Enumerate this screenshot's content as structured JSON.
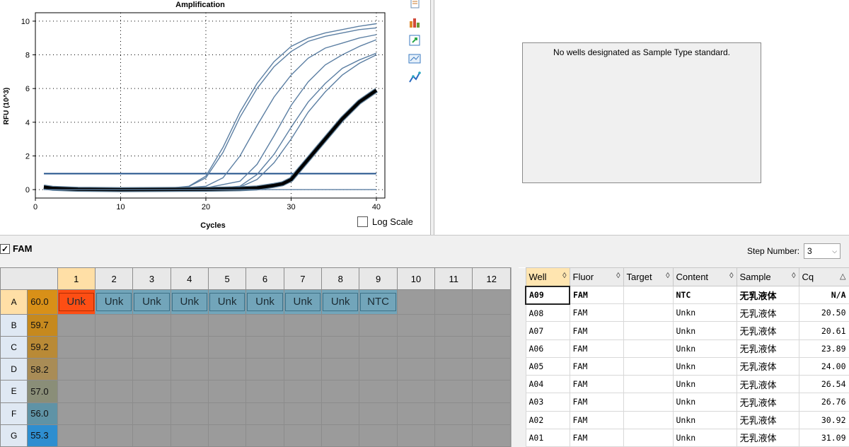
{
  "chart": {
    "title": "Amplification",
    "xlabel": "Cycles",
    "ylabel": "RFU (10^3)",
    "log_scale_label": "Log Scale"
  },
  "chart_data": {
    "type": "line",
    "title": "Amplification",
    "xlabel": "Cycles",
    "ylabel": "RFU (10^3)",
    "xlim": [
      0,
      41
    ],
    "ylim": [
      -0.5,
      10.5
    ],
    "xticks": [
      0,
      10,
      20,
      30,
      40
    ],
    "yticks": [
      0,
      2,
      4,
      6,
      8,
      10
    ],
    "grid": "dotted",
    "threshold": 0.95,
    "series": [
      {
        "x": [
          1,
          2,
          5,
          10,
          15,
          18,
          20,
          22,
          24,
          26,
          28,
          30,
          32,
          34,
          36,
          38,
          40
        ],
        "y": [
          0.1,
          0.05,
          0.02,
          0.0,
          0.05,
          0.2,
          0.8,
          2.5,
          4.6,
          6.3,
          7.6,
          8.5,
          9.0,
          9.3,
          9.5,
          9.7,
          9.85
        ]
      },
      {
        "x": [
          1,
          2,
          5,
          10,
          15,
          18,
          20,
          22,
          24,
          26,
          28,
          30,
          32,
          34,
          36,
          38,
          40
        ],
        "y": [
          0.15,
          0.08,
          0.02,
          0.0,
          0.04,
          0.18,
          0.7,
          2.2,
          4.3,
          6.0,
          7.3,
          8.2,
          8.8,
          9.1,
          9.3,
          9.5,
          9.6
        ]
      },
      {
        "x": [
          1,
          2,
          5,
          10,
          15,
          20,
          22,
          24,
          26,
          28,
          30,
          32,
          34,
          36,
          38,
          40
        ],
        "y": [
          0.1,
          0.05,
          0.02,
          0.0,
          0.02,
          0.2,
          0.7,
          2.0,
          3.8,
          5.5,
          6.8,
          7.8,
          8.4,
          8.7,
          9.0,
          9.2
        ]
      },
      {
        "x": [
          1,
          2,
          5,
          10,
          15,
          20,
          24,
          26,
          28,
          30,
          32,
          34,
          36,
          38,
          40
        ],
        "y": [
          0.1,
          0.05,
          0.02,
          0.0,
          0.02,
          0.1,
          0.5,
          1.5,
          3.2,
          5.0,
          6.4,
          7.4,
          8.0,
          8.5,
          8.9
        ]
      },
      {
        "x": [
          1,
          2,
          5,
          10,
          15,
          20,
          24,
          26,
          28,
          30,
          32,
          34,
          36,
          38,
          40
        ],
        "y": [
          0.25,
          0.1,
          0.02,
          0.0,
          0.02,
          0.05,
          0.2,
          0.9,
          2.1,
          3.7,
          5.2,
          6.3,
          7.2,
          7.7,
          8.1
        ]
      },
      {
        "x": [
          1,
          2,
          5,
          10,
          15,
          20,
          24,
          26,
          28,
          30,
          32,
          34,
          36,
          38,
          40
        ],
        "y": [
          0.2,
          0.1,
          0.02,
          0.0,
          0.02,
          0.05,
          0.15,
          0.6,
          1.6,
          3.0,
          4.6,
          5.8,
          6.8,
          7.5,
          8.0
        ]
      },
      {
        "x": [
          1,
          2,
          5,
          10,
          15,
          20,
          24,
          26,
          28,
          29,
          30,
          31,
          32,
          33,
          34,
          36,
          38,
          40
        ],
        "y": [
          0.15,
          0.08,
          0.02,
          0.0,
          0.01,
          0.02,
          0.05,
          0.1,
          0.25,
          0.35,
          0.6,
          1.2,
          1.8,
          2.4,
          3.0,
          4.2,
          5.2,
          5.9
        ],
        "highlight": true
      },
      {
        "x": [
          1,
          5,
          10,
          20,
          30,
          40
        ],
        "y": [
          0.0,
          0.0,
          0.0,
          0.0,
          0.0,
          0.0
        ]
      }
    ]
  },
  "icons": [
    "copy-icon",
    "bar-export-icon",
    "refresh-icon",
    "chart-tools-icon",
    "chart-line-icon"
  ],
  "standard_curve": {
    "message": "No wells designated as Sample Type standard."
  },
  "fluor_bar": {
    "fluor_label": "FAM",
    "checked": true,
    "step_label": "Step Number:",
    "step_value": "3"
  },
  "plate": {
    "columns": [
      "1",
      "2",
      "3",
      "4",
      "5",
      "6",
      "7",
      "8",
      "9",
      "10",
      "11",
      "12"
    ],
    "rows": [
      {
        "label": "A",
        "temp": "60.0",
        "temp_color": "#d89018"
      },
      {
        "label": "B",
        "temp": "59.7",
        "temp_color": "#c6891e"
      },
      {
        "label": "C",
        "temp": "59.2",
        "temp_color": "#b98a36"
      },
      {
        "label": "D",
        "temp": "58.2",
        "temp_color": "#a98c56"
      },
      {
        "label": "E",
        "temp": "57.0",
        "temp_color": "#8a8e78"
      },
      {
        "label": "F",
        "temp": "56.0",
        "temp_color": "#5f93a6"
      },
      {
        "label": "G",
        "temp": "55.3",
        "temp_color": "#2e8ed0"
      }
    ],
    "wells_row_a": [
      "Unk",
      "Unk",
      "Unk",
      "Unk",
      "Unk",
      "Unk",
      "Unk",
      "Unk",
      "NTC"
    ]
  },
  "results": {
    "headers": [
      "Well",
      "Fluor",
      "Target",
      "Content",
      "Sample",
      "Cq"
    ],
    "rows": [
      {
        "well": "A09",
        "fluor": "FAM",
        "target": "",
        "content": "NTC",
        "sample": "无乳液体",
        "cq": "N/A"
      },
      {
        "well": "A08",
        "fluor": "FAM",
        "target": "",
        "content": "Unkn",
        "sample": "无乳液体",
        "cq": "20.50"
      },
      {
        "well": "A07",
        "fluor": "FAM",
        "target": "",
        "content": "Unkn",
        "sample": "无乳液体",
        "cq": "20.61"
      },
      {
        "well": "A06",
        "fluor": "FAM",
        "target": "",
        "content": "Unkn",
        "sample": "无乳液体",
        "cq": "23.89"
      },
      {
        "well": "A05",
        "fluor": "FAM",
        "target": "",
        "content": "Unkn",
        "sample": "无乳液体",
        "cq": "24.00"
      },
      {
        "well": "A04",
        "fluor": "FAM",
        "target": "",
        "content": "Unkn",
        "sample": "无乳液体",
        "cq": "26.54"
      },
      {
        "well": "A03",
        "fluor": "FAM",
        "target": "",
        "content": "Unkn",
        "sample": "无乳液体",
        "cq": "26.76"
      },
      {
        "well": "A02",
        "fluor": "FAM",
        "target": "",
        "content": "Unkn",
        "sample": "无乳液体",
        "cq": "30.92"
      },
      {
        "well": "A01",
        "fluor": "FAM",
        "target": "",
        "content": "Unkn",
        "sample": "无乳液体",
        "cq": "31.09"
      }
    ]
  }
}
